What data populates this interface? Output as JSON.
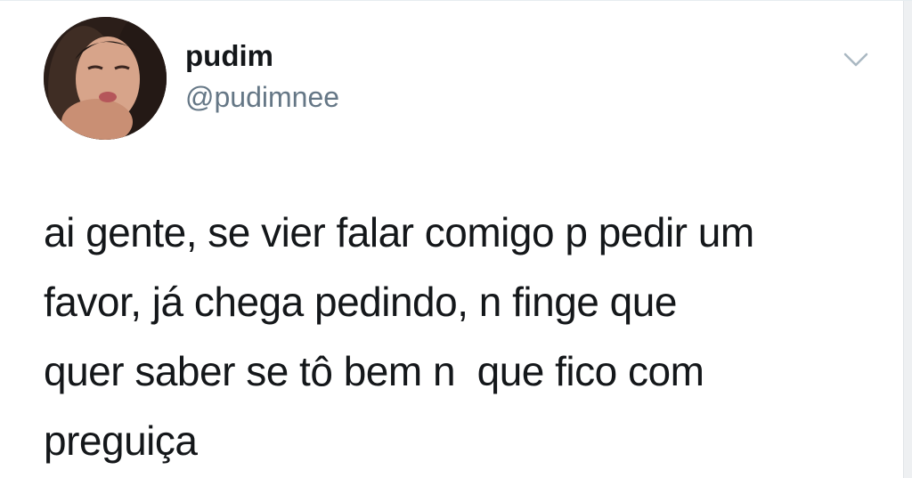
{
  "tweet": {
    "author_name": "pudim",
    "author_handle": "@pudimnee",
    "text_lines": [
      "ai gente, se vier falar comigo p pedir um",
      "favor, já chega pedindo, n finge que",
      "quer saber se tô bem n  que fico com",
      "preguiça"
    ],
    "menu_icon": "chevron-down-icon",
    "avatar_icon": "avatar"
  },
  "colors": {
    "name": "#14171a",
    "handle": "#657786",
    "text": "#14171a",
    "chevron": "#aab8c2"
  }
}
